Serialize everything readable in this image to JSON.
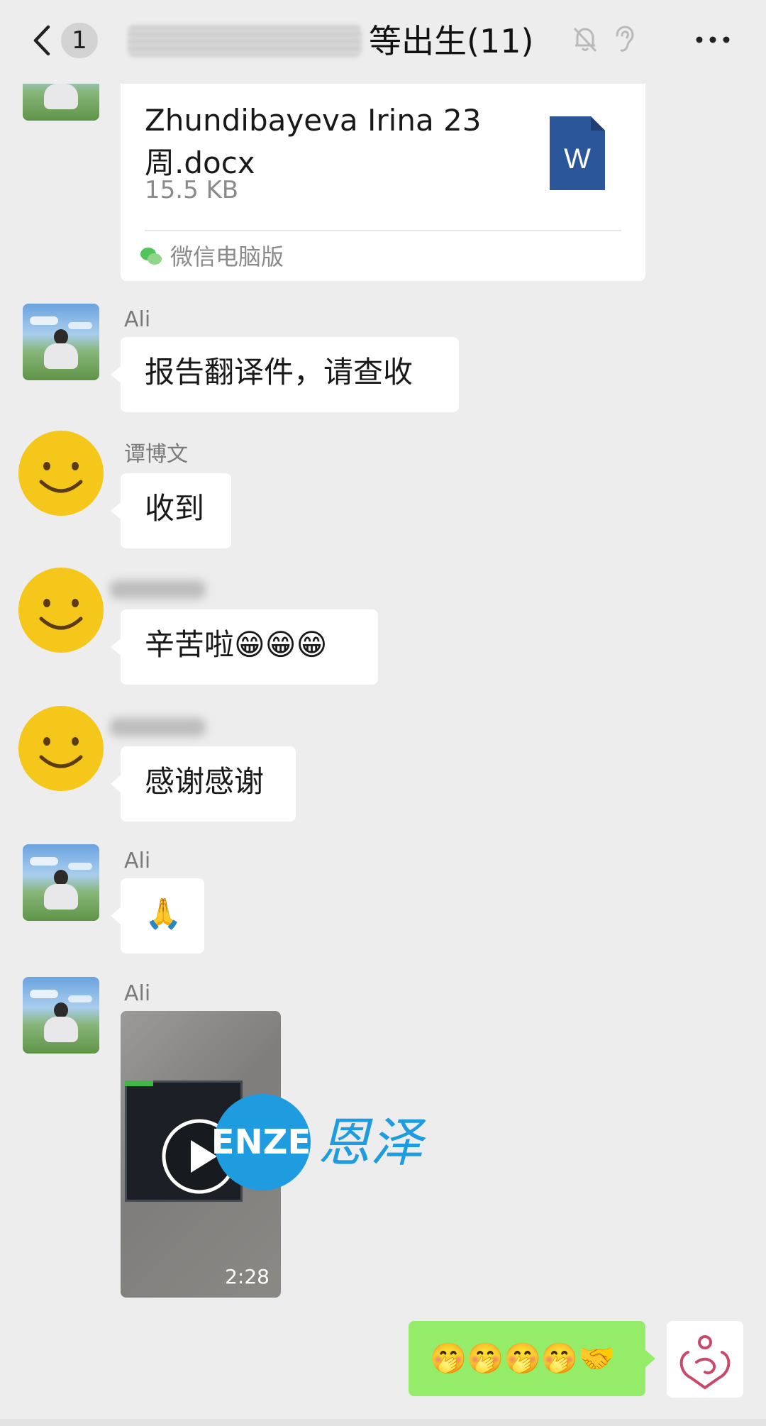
{
  "header": {
    "unread_count": "1",
    "title": "等出生(11)",
    "icons": [
      "back-icon",
      "mute-bell-icon",
      "ear-icon",
      "more-icon"
    ]
  },
  "messages": {
    "file": {
      "name": "Zhundibayeva Irina 23周.docx",
      "size": "15.5 KB",
      "source": "微信电脑版",
      "icon": "word-doc-icon"
    },
    "msg1": {
      "sender": "Ali",
      "text": "报告翻译件，请查收"
    },
    "msg2": {
      "sender": "谭博文",
      "text": "收到"
    },
    "msg3": {
      "text": "辛苦啦😁😁😁"
    },
    "msg4": {
      "text": "感谢感谢"
    },
    "msg5": {
      "sender": "Ali",
      "text": "🙏"
    },
    "msg6": {
      "sender": "Ali",
      "video_duration": "2:28"
    },
    "mine": {
      "text": "🤭🤭🤭🤭🤝"
    }
  },
  "watermark": {
    "brand": "ENZE",
    "chinese": "恩泽"
  },
  "colors": {
    "background": "#ededed",
    "bubble_other": "#ffffff",
    "bubble_mine": "#95ec69",
    "word_blue": "#2b579a",
    "watermark_blue": "#1f9ce0"
  }
}
